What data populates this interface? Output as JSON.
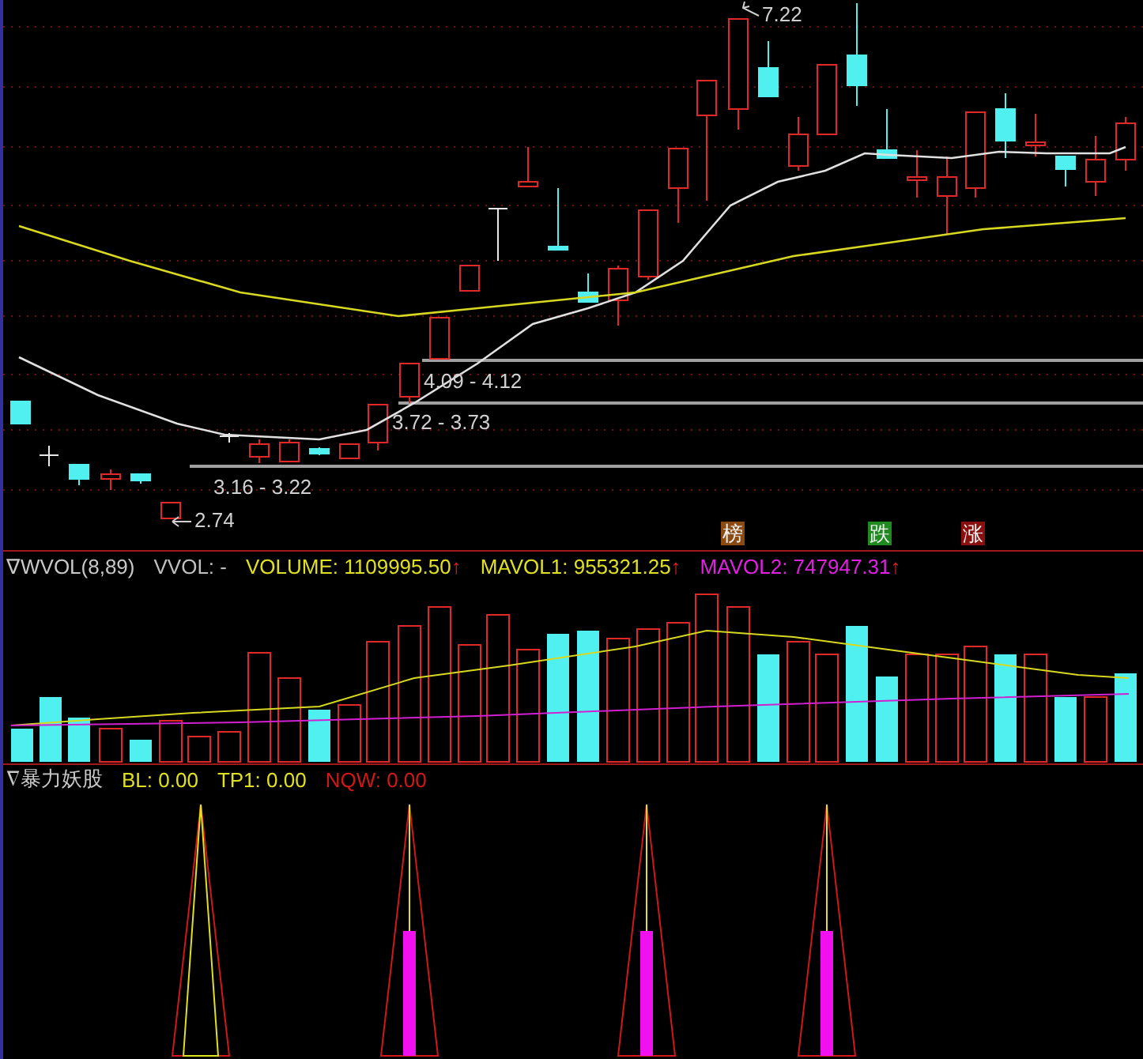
{
  "price_panel": {
    "annotations": [
      {
        "kind": "range",
        "text": "4.09 - 4.12"
      },
      {
        "kind": "range",
        "text": "3.72 - 3.73"
      },
      {
        "kind": "range",
        "text": "3.16 - 3.22"
      },
      {
        "kind": "low",
        "text": "2.74"
      },
      {
        "kind": "high",
        "text": "7.22"
      }
    ],
    "badges": [
      {
        "label": "榜",
        "color": "#8a4a12"
      },
      {
        "label": "跌",
        "color": "#1f8a1f"
      },
      {
        "label": "涨",
        "color": "#8a1010"
      }
    ]
  },
  "volume_panel": {
    "title": "∇WVOL(8,89)",
    "readouts": [
      {
        "label": "VVOL: -",
        "color": "#c0c0c0"
      },
      {
        "label": "VOLUME: 1109995.50",
        "color": "#e0e020",
        "arrow": "↑"
      },
      {
        "label": "MAVOL1: 955321.25",
        "color": "#e0e020",
        "arrow": "↑"
      },
      {
        "label": "MAVOL2: 747947.31",
        "color": "#e020e0",
        "arrow": "↑"
      }
    ]
  },
  "signal_panel": {
    "title": "∇暴力妖股",
    "readouts": [
      {
        "label": "BL: 0.00",
        "color": "#e0e020"
      },
      {
        "label": "TP1: 0.00",
        "color": "#e0e020"
      },
      {
        "label": "NQW: 0.00",
        "color": "#d01818"
      }
    ]
  }
}
